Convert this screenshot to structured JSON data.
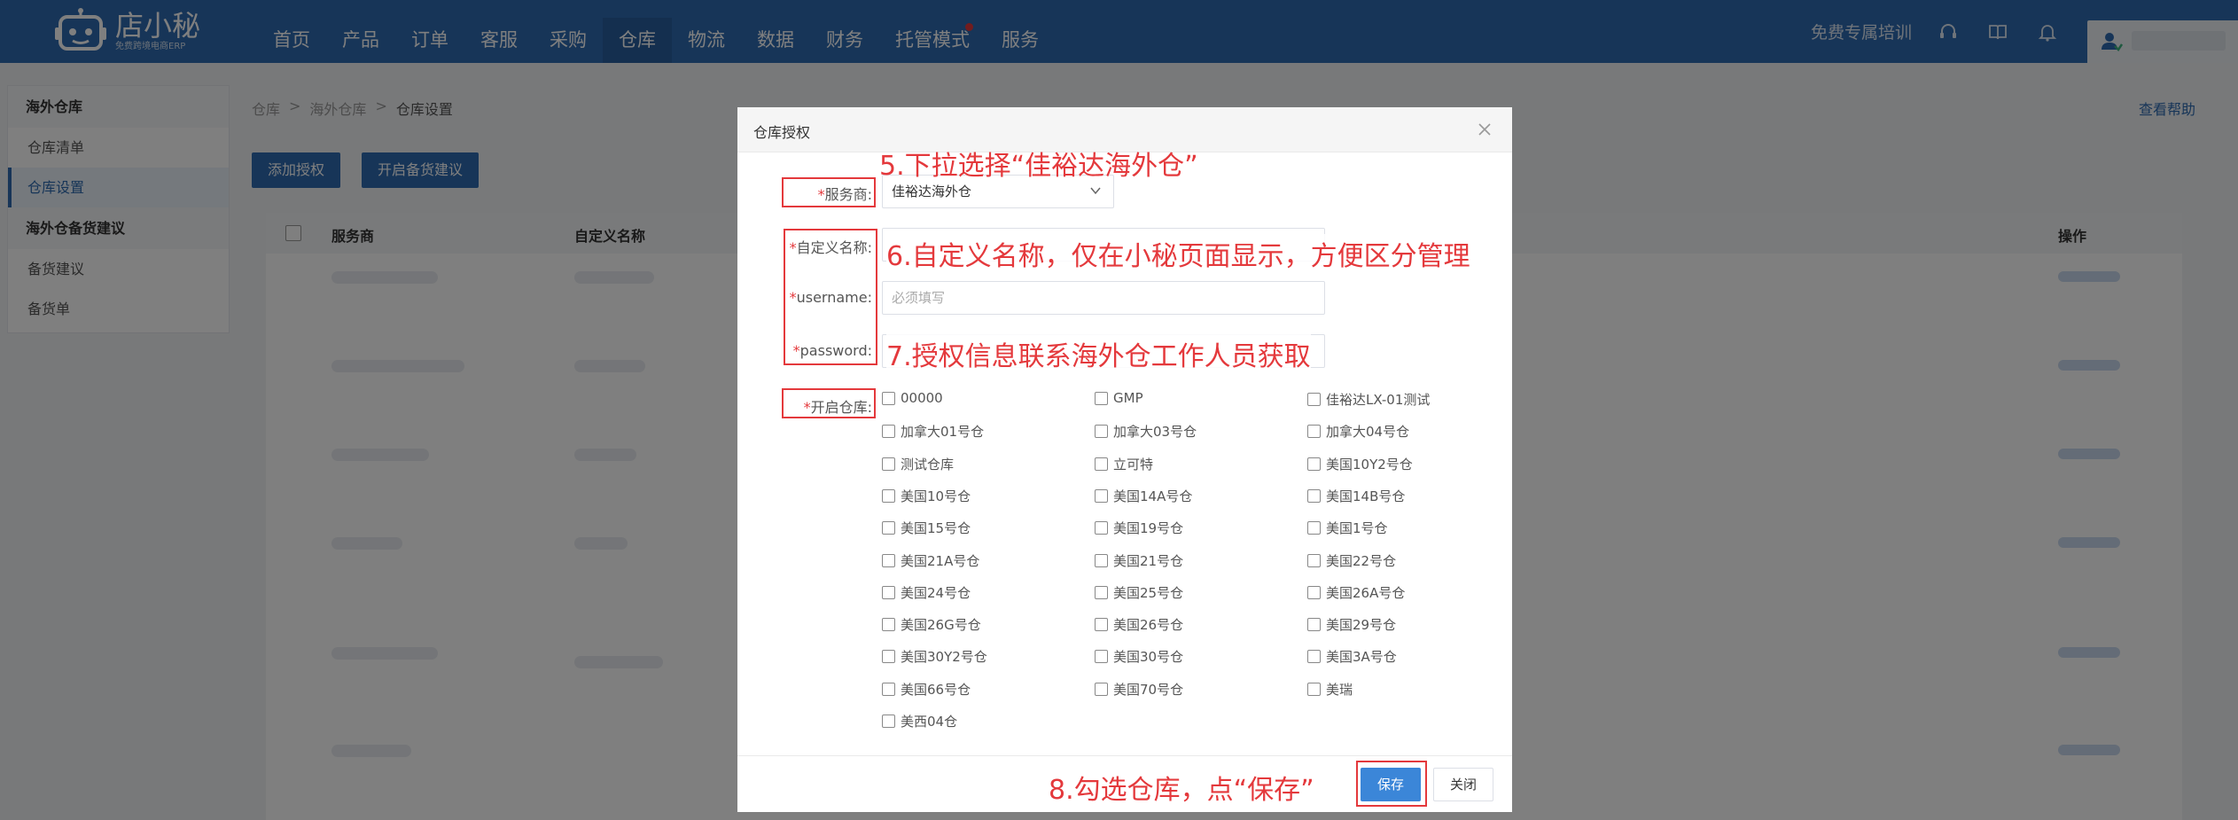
{
  "logo": {
    "name": "店小秘",
    "subtitle": "免费跨境电商ERP"
  },
  "nav": [
    "首页",
    "产品",
    "订单",
    "客服",
    "采购",
    "仓库",
    "物流",
    "数据",
    "财务",
    "托管模式",
    "服务"
  ],
  "nav_active_index": 5,
  "topbar": {
    "training": "免费专属培训"
  },
  "sidebar": {
    "group1": "海外仓库",
    "items1": [
      "仓库清单",
      "仓库设置"
    ],
    "group2": "海外仓备货建议",
    "items2": [
      "备货建议",
      "备货单"
    ]
  },
  "breadcrumb": [
    "仓库",
    "海外仓库",
    "仓库设置"
  ],
  "help": "查看帮助",
  "buttons": {
    "add_auth": "添加授权",
    "enable_suggest": "开启备货建议"
  },
  "table": {
    "col_provider": "服务商",
    "col_custom_name": "自定义名称",
    "col_action": "操作"
  },
  "modal": {
    "title": "仓库授权",
    "provider_label": "服务商:",
    "provider_value": "佳裕达海外仓",
    "custom_name_label": "自定义名称:",
    "username_label": "username:",
    "username_placeholder": "必须填写",
    "password_label": "password:",
    "warehouse_label": "开启仓库:",
    "warehouses": [
      "00000",
      "GMP",
      "佳裕达LX-01测试",
      "加拿大01号仓",
      "加拿大03号仓",
      "加拿大04号仓",
      "测试仓库",
      "立可特",
      "美国10Y2号仓",
      "美国10号仓",
      "美国14A号仓",
      "美国14B号仓",
      "美国15号仓",
      "美国19号仓",
      "美国1号仓",
      "美国21A号仓",
      "美国21号仓",
      "美国22号仓",
      "美国24号仓",
      "美国25号仓",
      "美国26A号仓",
      "美国26G号仓",
      "美国26号仓",
      "美国29号仓",
      "美国30Y2号仓",
      "美国30号仓",
      "美国3A号仓",
      "美国66号仓",
      "美国70号仓",
      "美瑞",
      "美西04仓"
    ],
    "save": "保存",
    "close": "关闭"
  },
  "annotations": {
    "step5": "5.下拉选择“佳裕达海外仓”",
    "step6": "6.自定义名称，仅在小秘页面显示，方便区分管理",
    "step7": "7.授权信息联系海外仓工作人员获取",
    "step8": "8.勾选仓库，点“保存”"
  }
}
